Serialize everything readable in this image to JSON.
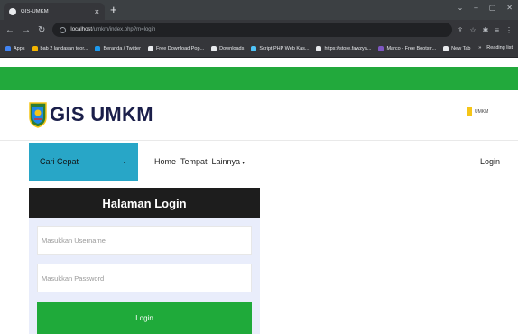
{
  "browser": {
    "tab_title": "GIS-UMKM",
    "tab_close": "×",
    "new_tab": "+",
    "window_controls": [
      "⌄",
      "–",
      "▢",
      "✕"
    ],
    "url_host": "localhost",
    "url_path": "/umkm/index.php?m=login",
    "bookmarks": [
      {
        "label": "Apps",
        "color": "#4285f4"
      },
      {
        "label": "bab 2 landasan teor...",
        "color": "#f4b400"
      },
      {
        "label": "Beranda / Twitter",
        "color": "#1d9bf0"
      },
      {
        "label": "Free Download Pop...",
        "color": "#e8eaed"
      },
      {
        "label": "Downloads",
        "color": "#e8eaed"
      },
      {
        "label": "Script PHP Web Kas...",
        "color": "#4fc3f7"
      },
      {
        "label": "https://store.fawzya...",
        "color": "#e8eaed"
      },
      {
        "label": "Marco - Free Bootstr...",
        "color": "#7e57c2"
      },
      {
        "label": "New Tab",
        "color": "#e8eaed"
      }
    ],
    "bookmarks_right": [
      "»",
      "Reading list"
    ]
  },
  "site": {
    "logo_text": "GIS UMKM",
    "badge_text": "UMKM",
    "brand_green": "#22a93c",
    "accent_cyan": "#28a6c7"
  },
  "navbar": {
    "cari_label": "Cari Cepat",
    "cari_chevron": "⌄",
    "menu": [
      "Home",
      "Tempat",
      "Lainnya"
    ],
    "caret": "▾",
    "login": "Login"
  },
  "login": {
    "title": "Halaman Login",
    "username_placeholder": "Masukkan Username",
    "password_placeholder": "Masukkan Password",
    "button": "Login"
  }
}
